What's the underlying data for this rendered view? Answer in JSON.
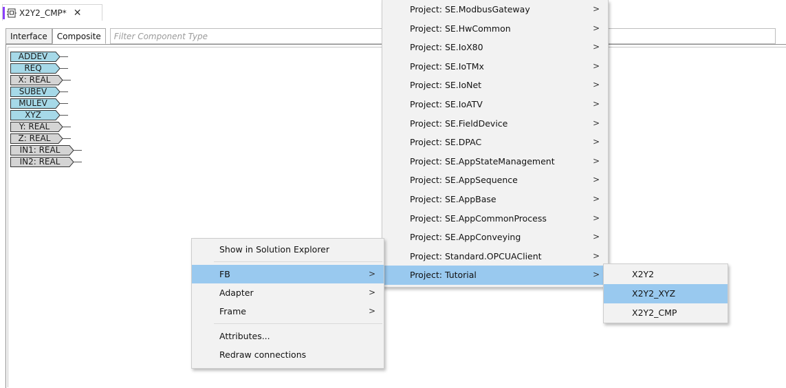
{
  "editor_tab": {
    "title": "X2Y2_CMP*",
    "close_glyph": "✕",
    "icon": "composite-fb-icon",
    "accent_color": "#8a3ffc"
  },
  "toolbar": {
    "tabs": [
      "Interface",
      "Composite"
    ],
    "filter_placeholder": "Filter Component Type"
  },
  "pins": [
    {
      "label": "ADDEV",
      "kind": "event"
    },
    {
      "label": "REQ",
      "kind": "event"
    },
    {
      "label": "X: REAL",
      "kind": "data"
    },
    {
      "label": "SUBEV",
      "kind": "event"
    },
    {
      "label": "MULEV",
      "kind": "event"
    },
    {
      "label": "XYZ",
      "kind": "event"
    },
    {
      "label": "Y: REAL",
      "kind": "data"
    },
    {
      "label": "Z: REAL",
      "kind": "data"
    },
    {
      "label": "IN1: REAL",
      "kind": "data"
    },
    {
      "label": "IN2: REAL",
      "kind": "data"
    }
  ],
  "colors": {
    "event_pin": "#a6d9e8",
    "data_pin": "#d4d4d4",
    "highlight": "#99c9ef"
  },
  "context_menu": {
    "items": [
      {
        "label": "Show in Solution Explorer",
        "submenu": false
      },
      {
        "label": "FB",
        "submenu": true,
        "highlighted": true
      },
      {
        "label": "Adapter",
        "submenu": true
      },
      {
        "label": "Frame",
        "submenu": true
      },
      {
        "label": "Attributes...",
        "submenu": false
      },
      {
        "label": "Redraw connections",
        "submenu": false
      }
    ],
    "arrow": ">"
  },
  "project_menu": {
    "items": [
      "Project: SE.ModbusGateway",
      "Project: SE.HwCommon",
      "Project: SE.IoX80",
      "Project: SE.IoTMx",
      "Project: SE.IoNet",
      "Project: SE.IoATV",
      "Project: SE.FieldDevice",
      "Project: SE.DPAC",
      "Project: SE.AppStateManagement",
      "Project: SE.AppSequence",
      "Project: SE.AppBase",
      "Project: SE.AppCommonProcess",
      "Project: SE.AppConveying",
      "Project: Standard.OPCUAClient",
      "Project: Tutorial"
    ],
    "highlighted_index": 14
  },
  "tutorial_menu": {
    "items": [
      "X2Y2",
      "X2Y2_XYZ",
      "X2Y2_CMP"
    ],
    "highlighted_index": 1
  }
}
